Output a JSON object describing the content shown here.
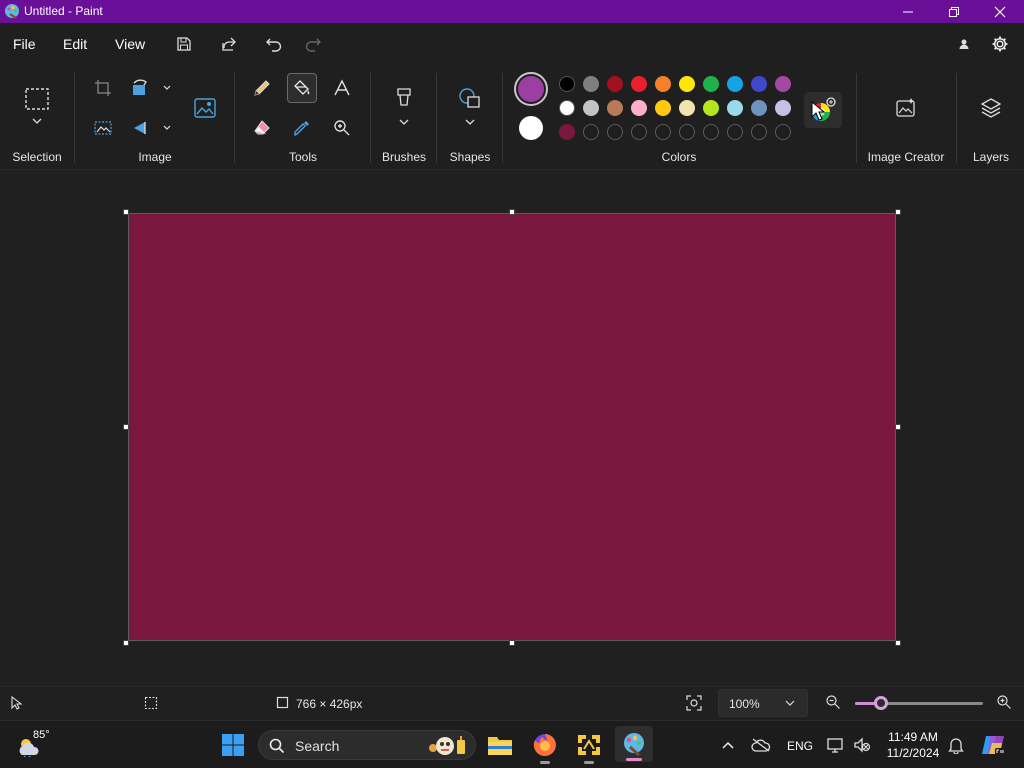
{
  "window": {
    "title": "Untitled - Paint",
    "titlebar_color": "#6a0f97"
  },
  "menu": {
    "file": "File",
    "edit": "Edit",
    "view": "View"
  },
  "ribbon": {
    "groups": {
      "selection": "Selection",
      "image": "Image",
      "tools": "Tools",
      "brushes": "Brushes",
      "shapes": "Shapes",
      "colors": "Colors",
      "image_creator": "Image Creator",
      "layers": "Layers"
    },
    "selected_tool": "fill-bucket"
  },
  "colors": {
    "color1": "#9b3fa3",
    "color2": "#ffffff",
    "palette_row1": [
      "#000000",
      "#7f7f7f",
      "#a4101f",
      "#e8202b",
      "#f4802a",
      "#fde50d",
      "#1fb24a",
      "#14a3e7",
      "#3f48cc",
      "#a349a4"
    ],
    "palette_row2": [
      "#ffffff",
      "#c3c3c3",
      "#b97a57",
      "#ffaec9",
      "#ffc90e",
      "#efe4b0",
      "#b5e61d",
      "#99d9ea",
      "#7092be",
      "#c8bfe7"
    ],
    "custom_row": [
      "#79173f",
      "",
      "",
      "",
      "",
      "",
      "",
      "",
      "",
      ""
    ]
  },
  "canvas": {
    "fill_color": "#79173f"
  },
  "status": {
    "canvas_size": "766 × 426px",
    "zoom": "100%",
    "zoom_slider_value": 0.2
  },
  "taskbar": {
    "weather_temp": "85°",
    "search_placeholder": "Search",
    "language": "ENG",
    "time": "11:49 AM",
    "date": "11/2/2024"
  }
}
